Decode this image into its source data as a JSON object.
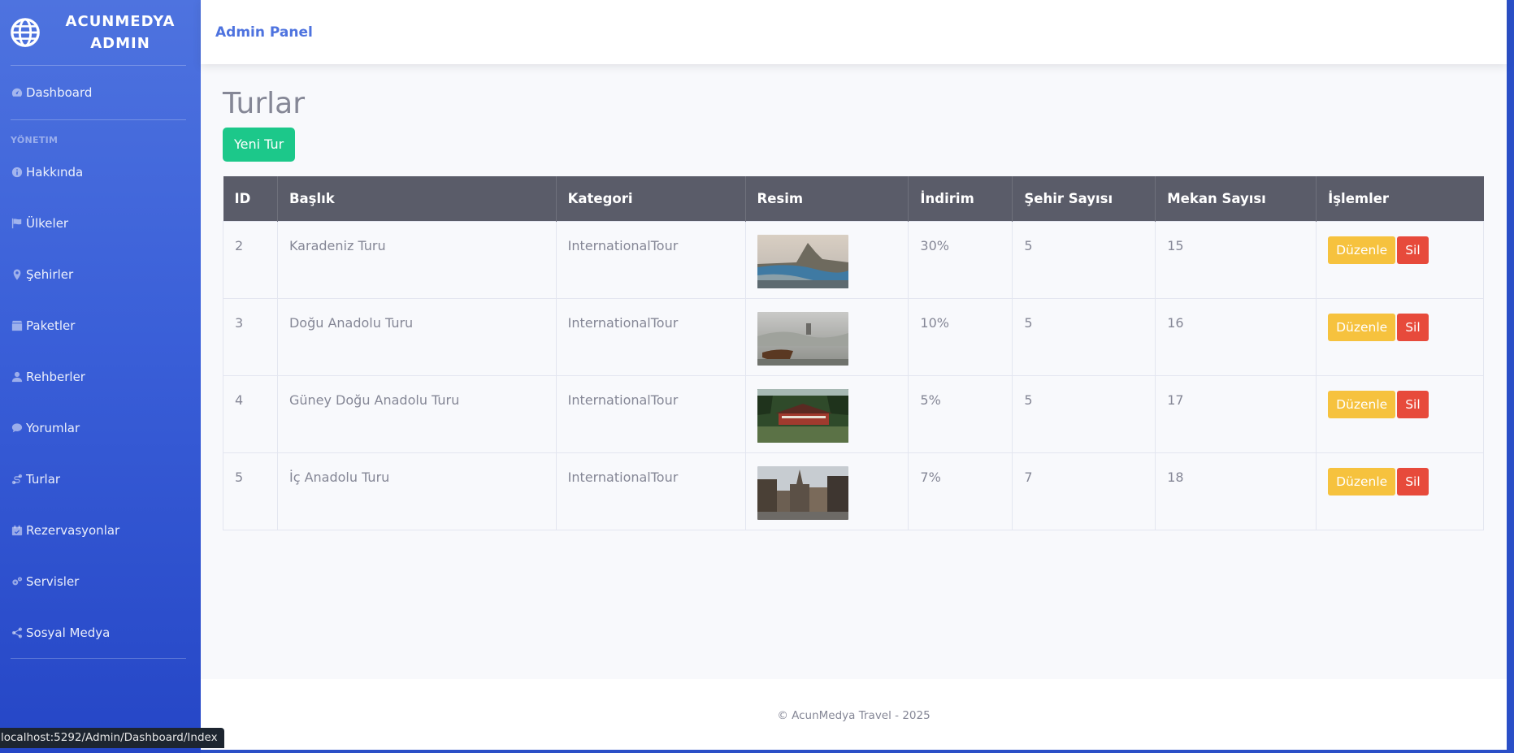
{
  "brand": {
    "line1": "ACUNMEDYA",
    "line2": "ADMIN"
  },
  "sidebar": {
    "dashboard": "Dashboard",
    "heading": "YÖNETIM",
    "items": [
      {
        "label": "Hakkında",
        "icon": "info-icon"
      },
      {
        "label": "Ülkeler",
        "icon": "flag-icon"
      },
      {
        "label": "Şehirler",
        "icon": "map-marker-icon"
      },
      {
        "label": "Paketler",
        "icon": "box-icon"
      },
      {
        "label": "Rehberler",
        "icon": "user-icon"
      },
      {
        "label": "Yorumlar",
        "icon": "comment-icon"
      },
      {
        "label": "Turlar",
        "icon": "route-icon"
      },
      {
        "label": "Rezervasyonlar",
        "icon": "calendar-icon"
      },
      {
        "label": "Servisler",
        "icon": "cogs-icon"
      },
      {
        "label": "Sosyal Medya",
        "icon": "share-icon"
      }
    ]
  },
  "topbar": {
    "title": "Admin Panel"
  },
  "page": {
    "title": "Turlar",
    "new_button": "Yeni Tur"
  },
  "table": {
    "headers": [
      "ID",
      "Başlık",
      "Kategori",
      "Resim",
      "İndirim",
      "Şehir Sayısı",
      "Mekan Sayısı",
      "İşlemler"
    ],
    "rows": [
      {
        "id": "2",
        "title": "Karadeniz Turu",
        "category": "InternationalTour",
        "discount": "30%",
        "cities": "5",
        "places": "15"
      },
      {
        "id": "3",
        "title": "Doğu Anadolu Turu",
        "category": "InternationalTour",
        "discount": "10%",
        "cities": "5",
        "places": "16"
      },
      {
        "id": "4",
        "title": "Güney Doğu Anadolu Turu",
        "category": "InternationalTour",
        "discount": "5%",
        "cities": "5",
        "places": "17"
      },
      {
        "id": "5",
        "title": "İç Anadolu Turu",
        "category": "InternationalTour",
        "discount": "7%",
        "cities": "7",
        "places": "18"
      }
    ],
    "edit_label": "Düzenle",
    "delete_label": "Sil"
  },
  "footer": {
    "text": "© AcunMedya Travel - 2025"
  },
  "statusbar": {
    "url": "localhost:5292/Admin/Dashboard/Index"
  },
  "colors": {
    "primary": "#4e73df",
    "success": "#1cc88a",
    "warning": "#f6c23e",
    "danger": "#e74a3b",
    "header_dark": "#5a5c69"
  }
}
